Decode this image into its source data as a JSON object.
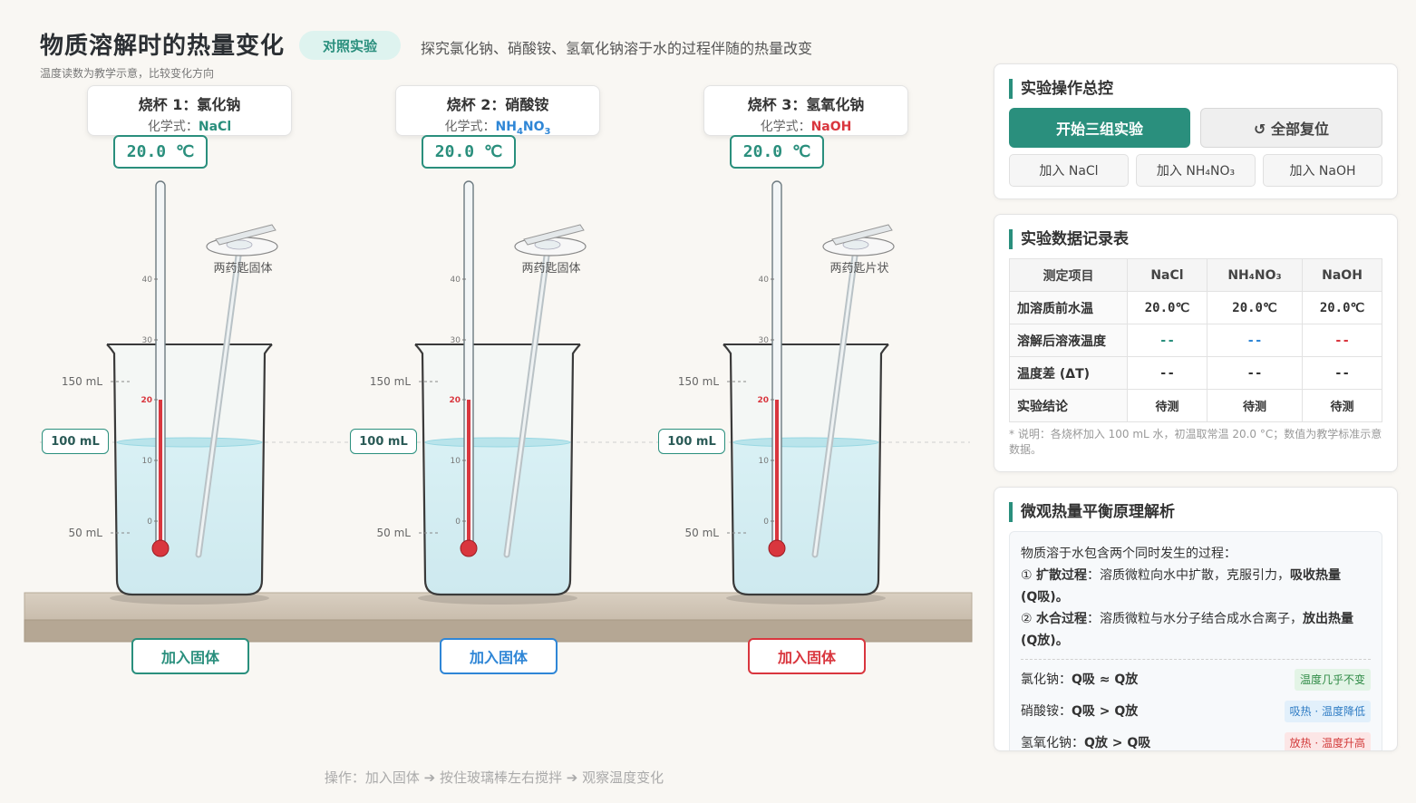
{
  "header": {
    "title": "物质溶解时的热量变化",
    "tag": "对照实验",
    "description": "探究氯化钠、硝酸铵、氢氧化钠溶于水的过程伴随的热量改变",
    "note": "温度读数为教学示意，比较变化方向"
  },
  "beakers": [
    {
      "title": "烧杯 1：氯化钠",
      "formula_prefix": "化学式：",
      "formula": "NaCl",
      "temp": "20.0 ℃",
      "spoon_label": "两药匙固体",
      "volume_label": "100 mL",
      "tick_150": "150 mL",
      "tick_50": "50 mL",
      "add_button": "加入固体",
      "color": "#2a8f7d",
      "thermo_ticks": [
        "40",
        "30",
        "20",
        "10",
        "0"
      ]
    },
    {
      "title": "烧杯 2：硝酸铵",
      "formula_prefix": "化学式：",
      "formula_parts": [
        "NH",
        "4",
        "NO",
        "3"
      ],
      "temp": "20.0 ℃",
      "spoon_label": "两药匙固体",
      "volume_label": "100 mL",
      "tick_150": "150 mL",
      "tick_50": "50 mL",
      "add_button": "加入固体",
      "color": "#2f86d6",
      "thermo_ticks": [
        "40",
        "30",
        "20",
        "10",
        "0"
      ]
    },
    {
      "title": "烧杯 3：氢氧化钠",
      "formula_prefix": "化学式：",
      "formula": "NaOH",
      "temp": "20.0 ℃",
      "spoon_label": "两药匙片状",
      "volume_label": "100 mL",
      "tick_150": "150 mL",
      "tick_50": "50 mL",
      "add_button": "加入固体",
      "color": "#d9363e",
      "thermo_ticks": [
        "40",
        "30",
        "20",
        "10",
        "0"
      ]
    }
  ],
  "footer": "操作：加入固体 ➔ 按住玻璃棒左右搅拌 ➔ 观察温度变化",
  "control": {
    "heading": "实验操作总控",
    "start": "开始三组实验",
    "reset": "↺ 全部复位",
    "add_nacl": "加入 NaCl",
    "add_nh4no3": "加入 NH₄NO₃",
    "add_naoh": "加入 NaOH"
  },
  "table": {
    "heading": "实验数据记录表",
    "columns": [
      "测定项目",
      "NaCl",
      "NH₄NO₃",
      "NaOH"
    ],
    "rows": [
      {
        "label": "加溶质前水温",
        "values": [
          "20.0℃",
          "20.0℃",
          "20.0℃"
        ]
      },
      {
        "label": "溶解后溶液温度",
        "values": [
          "--",
          "--",
          "--"
        ]
      },
      {
        "label": "温度差 (ΔT)",
        "values": [
          "--",
          "--",
          "--"
        ]
      },
      {
        "label": "实验结论",
        "values": [
          "待测",
          "待测",
          "待测"
        ]
      }
    ],
    "note": "* 说明：各烧杯加入 100 mL 水，初温取常温 20.0 °C；数值为教学标准示意数据。"
  },
  "micro": {
    "heading": "微观热量平衡原理解析",
    "intro": "物质溶于水包含两个同时发生的过程：",
    "p1_num": "① ",
    "p1_bold": "扩散过程",
    "p1_text": "：溶质微粒向水中扩散，克服引力，",
    "p1_emph": "吸收热量",
    "p1_q": "(Q吸)。",
    "p2_num": "② ",
    "p2_bold": "水合过程",
    "p2_text": "：溶质微粒与水分子结合成水合离子，",
    "p2_emph": "放出热量",
    "p2_q": "(Q放)。",
    "rows": [
      {
        "name": "氯化钠：",
        "rel": "Q吸 ≈ Q放",
        "badge": "温度几乎不变",
        "badge_bg": "#e3f4e6",
        "badge_fg": "#2e8a45"
      },
      {
        "name": "硝酸铵：",
        "rel": "Q吸 > Q放",
        "badge": "吸热 · 温度降低",
        "badge_bg": "#e2f0fb",
        "badge_fg": "#2f7cc4"
      },
      {
        "name": "氢氧化钠：",
        "rel": "Q放 > Q吸",
        "badge": "放热 · 温度升高",
        "badge_bg": "#fce6e6",
        "badge_fg": "#d23a3a"
      }
    ]
  }
}
